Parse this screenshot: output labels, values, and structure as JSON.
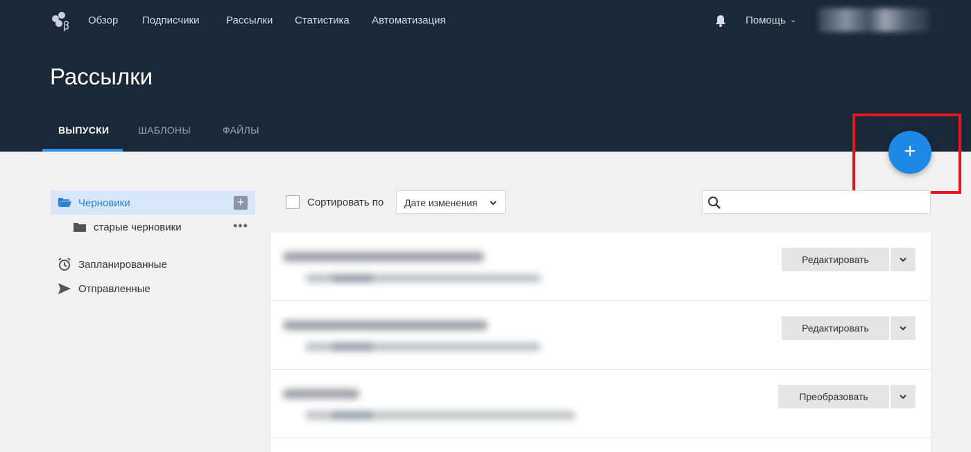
{
  "nav": {
    "items": [
      "Обзор",
      "Подписчики",
      "Рассылки",
      "Статистика",
      "Автоматизация"
    ],
    "help_label": "Помощь"
  },
  "page": {
    "title": "Рассылки"
  },
  "tabs": [
    "ВЫПУСКИ",
    "ШАБЛОНЫ",
    "ФАЙЛЫ"
  ],
  "active_tab": "ВЫПУСКИ",
  "fab": {
    "label": "+"
  },
  "sidebar": {
    "active_folder": "Черновики",
    "subfolder": "старые черновики",
    "links": [
      "Запланированные",
      "Отправленные"
    ]
  },
  "toolbar": {
    "sort_label": "Сортировать по",
    "sort_value": "Дате изменения",
    "search_placeholder": ""
  },
  "rows": [
    {
      "action": "Редактировать"
    },
    {
      "action": "Редактировать"
    },
    {
      "action": "Преобразовать"
    }
  ],
  "colors": {
    "header_bg": "#1b2838",
    "accent": "#1e88e5",
    "highlight": "#e8141b",
    "active_folder_bg": "#d7e6f9"
  },
  "icons": {
    "logo": "logo-icon",
    "bell": "bell-icon",
    "folder_open": "folder-open-icon",
    "folder": "folder-icon",
    "alarm": "alarm-clock-icon",
    "send": "send-icon",
    "search": "search-icon",
    "chevron": "chevron-down-icon"
  }
}
